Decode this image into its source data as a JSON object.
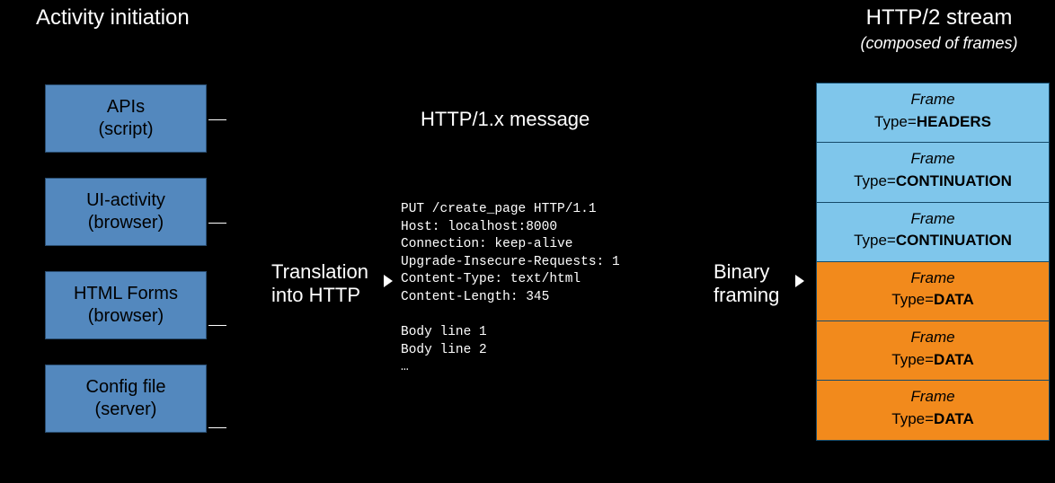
{
  "left": {
    "title": "Activity initiation",
    "boxes": [
      {
        "line1": "APIs",
        "line2": "(script)"
      },
      {
        "line1": "UI-activity",
        "line2": "(browser)"
      },
      {
        "line1": "HTML Forms",
        "line2": "(browser)"
      },
      {
        "line1": "Config file",
        "line2": "(server)"
      }
    ]
  },
  "translation": {
    "line1": "Translation",
    "line2": "into HTTP"
  },
  "msg": {
    "title": "HTTP/1.x message",
    "raw": "PUT /create_page HTTP/1.1\nHost: localhost:8000\nConnection: keep-alive\nUpgrade-Insecure-Requests: 1\nContent-Type: text/html\nContent-Length: 345\n\nBody line 1\nBody line 2\n…"
  },
  "binary": {
    "line1": "Binary",
    "line2": "framing"
  },
  "right": {
    "title": "HTTP/2 stream",
    "subtitle": "(composed of frames)",
    "frames": [
      {
        "kind": "head",
        "label": "Frame",
        "type": "HEADERS"
      },
      {
        "kind": "head",
        "label": "Frame",
        "type": "CONTINUATION"
      },
      {
        "kind": "head",
        "label": "Frame",
        "type": "CONTINUATION"
      },
      {
        "kind": "data",
        "label": "Frame",
        "type": "DATA"
      },
      {
        "kind": "data",
        "label": "Frame",
        "type": "DATA"
      },
      {
        "kind": "data",
        "label": "Frame",
        "type": "DATA"
      }
    ]
  }
}
